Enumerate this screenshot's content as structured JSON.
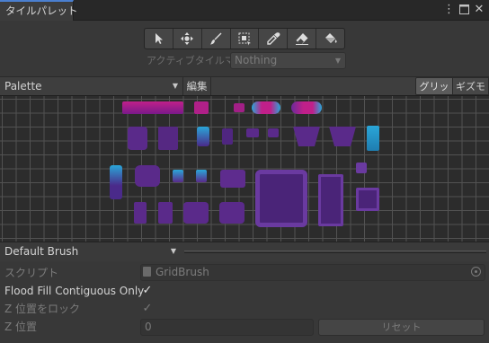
{
  "window": {
    "tab_title": "タイルパレット",
    "header_icons": [
      "more-options-icon",
      "maximize-icon",
      "close-icon"
    ]
  },
  "toolbar": {
    "tools": [
      {
        "name": "select-tool",
        "icon": "arrow-cursor-icon"
      },
      {
        "name": "move-tool",
        "icon": "move-icon"
      },
      {
        "name": "paint-tool",
        "icon": "brush-icon"
      },
      {
        "name": "box-fill-tool",
        "icon": "box-fill-icon"
      },
      {
        "name": "picker-tool",
        "icon": "eyedropper-icon"
      },
      {
        "name": "erase-tool",
        "icon": "eraser-icon"
      },
      {
        "name": "fill-tool",
        "icon": "paint-bucket-icon"
      }
    ]
  },
  "active_tilemap": {
    "label": "アクティブタイルマッ",
    "value": "Nothing"
  },
  "palette_bar": {
    "palette_value": "Palette",
    "edit_label": "編集",
    "grid_label": "グリッド",
    "gizmo_label": "ギズモ",
    "grid_active": true
  },
  "brush": {
    "value": "Default Brush"
  },
  "inspector": {
    "script_label": "スクリプト",
    "script_value": "GridBrush",
    "flood_fill_label": "Flood Fill Contiguous Only",
    "flood_fill_checked": true,
    "lock_z_label": "Z 位置をロック",
    "lock_z_checked": true,
    "z_position_label": "Z 位置",
    "z_position_value": "0",
    "reset_label": "リセット"
  },
  "colors": {
    "tile_purple": "#5a2a8a",
    "tile_magenta": "#c0208a",
    "tile_cyan": "#2aa6d8",
    "accent_tab": "#4a7fd0"
  }
}
